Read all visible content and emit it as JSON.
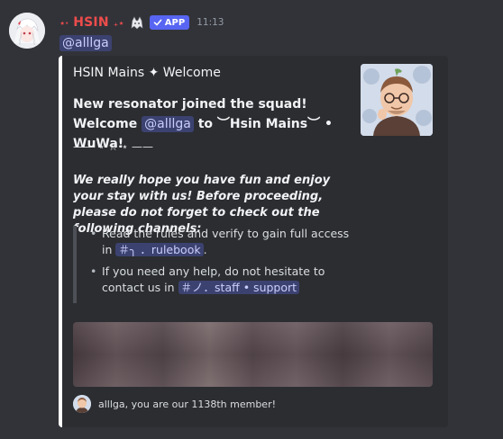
{
  "message": {
    "username": "HSIN",
    "username_prefix": "⋆‧",
    "username_suffix": "₊⋆",
    "app_tag": "APP",
    "timestamp": "11:13",
    "mention": "@alllga"
  },
  "embed": {
    "author": "HSIN Mains ✦ Welcome",
    "title_text_1": "New resonator joined the squad! Welcome",
    "title_mention": "@alllga",
    "title_text_2": " to ︶Hsin Mains︶ • WuWa!",
    "divider": "—— ⋆·☆·⋆ ——",
    "intro": "We really hope you have fun and enjoy your stay with us! Before proceeding, please do not forget to check out the following channels:",
    "bullets": [
      {
        "text": "Read the rules and verify to gain full access in",
        "channel": "＃╮ ．rulebook",
        "tail": "."
      },
      {
        "text": "If you need any help, do not hesitate to contact us in",
        "channel": "＃ノ．staff • support",
        "tail": ""
      }
    ],
    "footer": "alllga, you are our 1138th member!"
  },
  "colors": {
    "background": "#323339",
    "embed_background": "#2b2d31",
    "embed_accent": "#ffffff",
    "username": "#ef4c4c",
    "app_tag": "#5865f2",
    "mention_bg": "#3c4270",
    "mention_text": "#c9cdfb"
  },
  "icons": {
    "role_icon": "white-wolf-role-icon",
    "app_check": "checkmark-icon"
  }
}
